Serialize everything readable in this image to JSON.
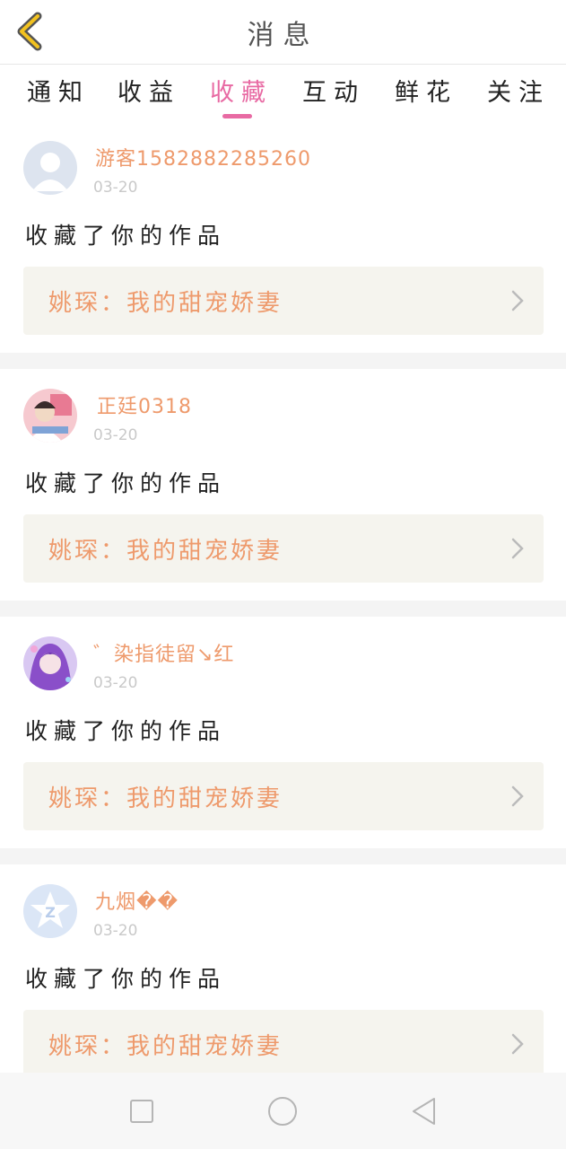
{
  "header": {
    "title": "消息",
    "back_icon": "chevron-left-icon",
    "accent": "#f2a11f"
  },
  "tabs": [
    {
      "label": "通知",
      "active": false
    },
    {
      "label": "收益",
      "active": false
    },
    {
      "label": "收藏",
      "active": true
    },
    {
      "label": "互动",
      "active": false
    },
    {
      "label": "鲜花",
      "active": false
    },
    {
      "label": "关注",
      "active": false
    }
  ],
  "colors": {
    "active_tab": "#e86aa3",
    "username": "#ee9a6c",
    "date": "#c9c9c9",
    "work_box": "#f5f4ee"
  },
  "messages": [
    {
      "username": "游客1582882285260",
      "date": "03-20",
      "action": "收藏了你的作品",
      "work_title": "姚琛：我的甜宠娇妻",
      "avatar": "default-user-avatar"
    },
    {
      "username": "正廷0318",
      "date": "03-20",
      "action": "收藏了你的作品",
      "work_title": "姚琛：我的甜宠娇妻",
      "avatar": "photo-avatar"
    },
    {
      "username": "゛染指徒留↘红",
      "date": "03-20",
      "action": "收藏了你的作品",
      "work_title": "姚琛：我的甜宠娇妻",
      "avatar": "anime-avatar"
    },
    {
      "username": "九烟��",
      "date": "03-20",
      "action": "收藏了你的作品",
      "work_title": "姚琛：我的甜宠娇妻",
      "avatar": "qq-avatar"
    }
  ],
  "system_nav": {
    "recents_icon": "square-icon",
    "home_icon": "circle-icon",
    "back_icon": "triangle-back-icon"
  }
}
